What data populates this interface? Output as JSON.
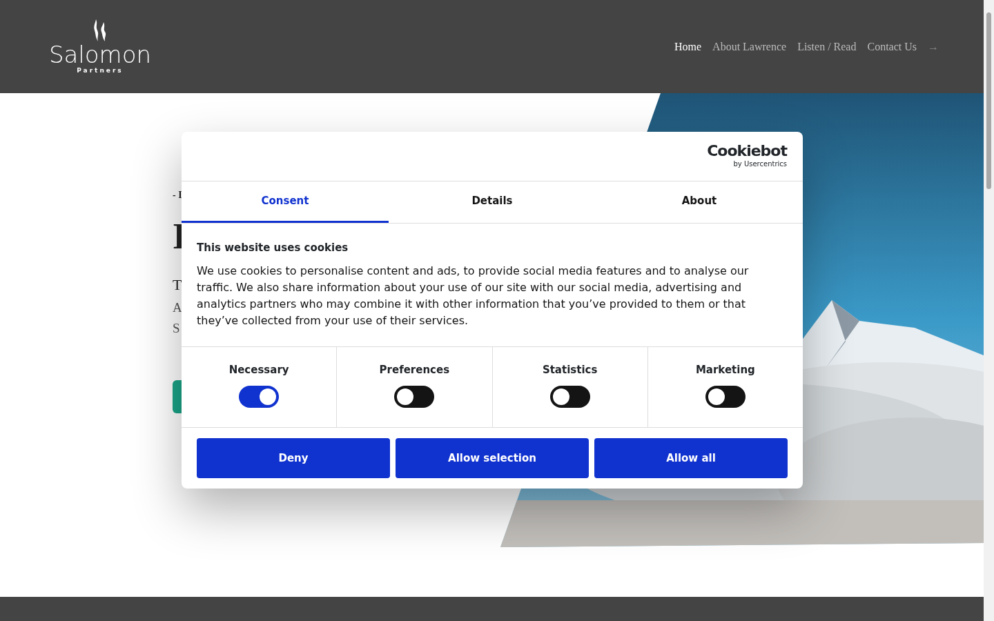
{
  "header": {
    "logo_word": "Salomon",
    "logo_sub": "Partners",
    "nav": [
      {
        "label": "Home",
        "selected": true
      },
      {
        "label": "About Lawrence",
        "selected": false
      },
      {
        "label": "Listen / Read",
        "selected": false
      },
      {
        "label": "Contact Us",
        "selected": false
      }
    ],
    "nav_arrow": "→"
  },
  "hero": {
    "lines": [
      {
        "kind": "eyebrow",
        "text": "- I"
      },
      {
        "kind": "title",
        "text": "I"
      },
      {
        "kind": "subtitle",
        "text": "T"
      },
      {
        "kind": "body",
        "text": "A"
      },
      {
        "kind": "body",
        "text": "S"
      }
    ],
    "button": {
      "kind": "cta"
    }
  },
  "cookie_dialog": {
    "brand": "Cookiebot",
    "brand_sub": "by Usercentrics",
    "tabs": [
      {
        "label": "Consent",
        "selected": true
      },
      {
        "label": "Details",
        "selected": false
      },
      {
        "label": "About",
        "selected": false
      }
    ],
    "heading": "This website uses cookies",
    "text": "We use cookies to personalise content and ads, to provide social media features and to analyse our traffic. We also share information about your use of our site with our social media, advertising and analytics partners who may combine it with other information that you’ve provided to them or that they’ve collected from your use of their services.",
    "categories": [
      {
        "label": "Necessary",
        "on": true
      },
      {
        "label": "Preferences",
        "on": false
      },
      {
        "label": "Statistics",
        "on": false
      },
      {
        "label": "Marketing",
        "on": false
      }
    ],
    "buttons": [
      "Deny",
      "Allow selection",
      "Allow all"
    ]
  }
}
